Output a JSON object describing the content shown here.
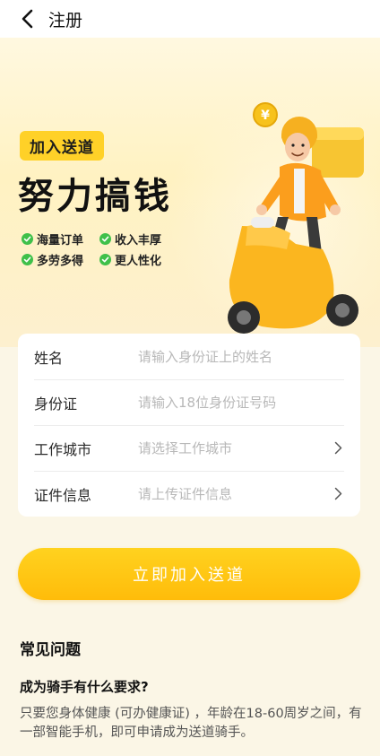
{
  "header": {
    "title": "注册",
    "back_icon": "chevron-left-icon"
  },
  "hero": {
    "badge": "加入送道",
    "slogan": "努力搞钱",
    "features": [
      "海量订单",
      "收入丰厚",
      "多劳多得",
      "更人性化"
    ],
    "accent_color": "#ffd128",
    "check_color": "#3fc04a",
    "illustration": "delivery-rider-scooter"
  },
  "form": {
    "fields": [
      {
        "label": "姓名",
        "placeholder": "请输入身份证上的姓名",
        "has_arrow": false
      },
      {
        "label": "身份证",
        "placeholder": "请输入18位身份证号码",
        "has_arrow": false
      },
      {
        "label": "工作城市",
        "placeholder": "请选择工作城市",
        "has_arrow": true
      },
      {
        "label": "证件信息",
        "placeholder": "请上传证件信息",
        "has_arrow": true
      }
    ]
  },
  "cta": {
    "label": "立即加入送道",
    "color": "#ffc414"
  },
  "faq": {
    "title": "常见问题",
    "question": "成为骑手有什么要求?",
    "answer": "只要您身体健康 (可办健康证) ，年龄在18-60周岁之间，有一部智能手机，即可申请成为送道骑手。"
  }
}
